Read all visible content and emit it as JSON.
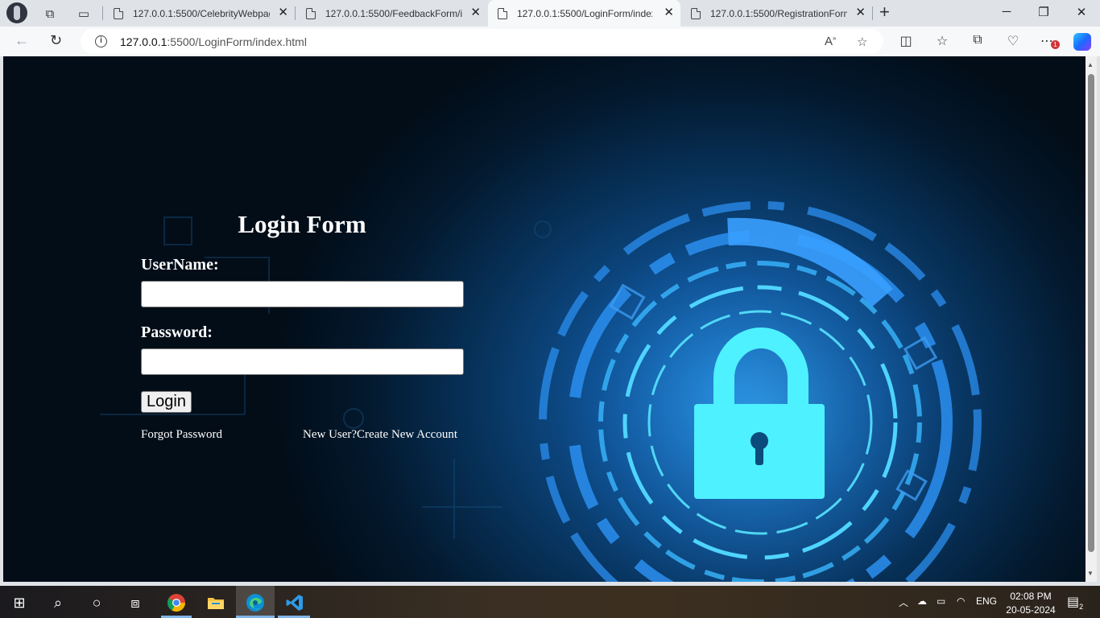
{
  "browser": {
    "tabs": [
      {
        "title": "127.0.0.1:5500/CelebrityWebpage",
        "active": false
      },
      {
        "title": "127.0.0.1:5500/FeedbackForm/in",
        "active": false
      },
      {
        "title": "127.0.0.1:5500/LoginForm/index.",
        "active": true
      },
      {
        "title": "127.0.0.1:5500/RegistrationForm/",
        "active": false
      }
    ],
    "url_host": "127.0.0.1",
    "url_rest": ":5500/LoginForm/index.html"
  },
  "page": {
    "title": "Login Form",
    "username_label": "UserName:",
    "password_label": "Password:",
    "username_value": "",
    "password_value": "",
    "login_button": "Login",
    "forgot_link": "Forgot Password",
    "register_link": "New User?Create New Account"
  },
  "taskbar": {
    "language": "ENG",
    "time": "02:08 PM",
    "date": "20-05-2024",
    "notification_count": "2",
    "browser_menu_badge": "1"
  },
  "colors": {
    "page_bg": "#03192e",
    "lock_glow": "#4ef1ff",
    "ring_blue": "#2b8ff0"
  }
}
